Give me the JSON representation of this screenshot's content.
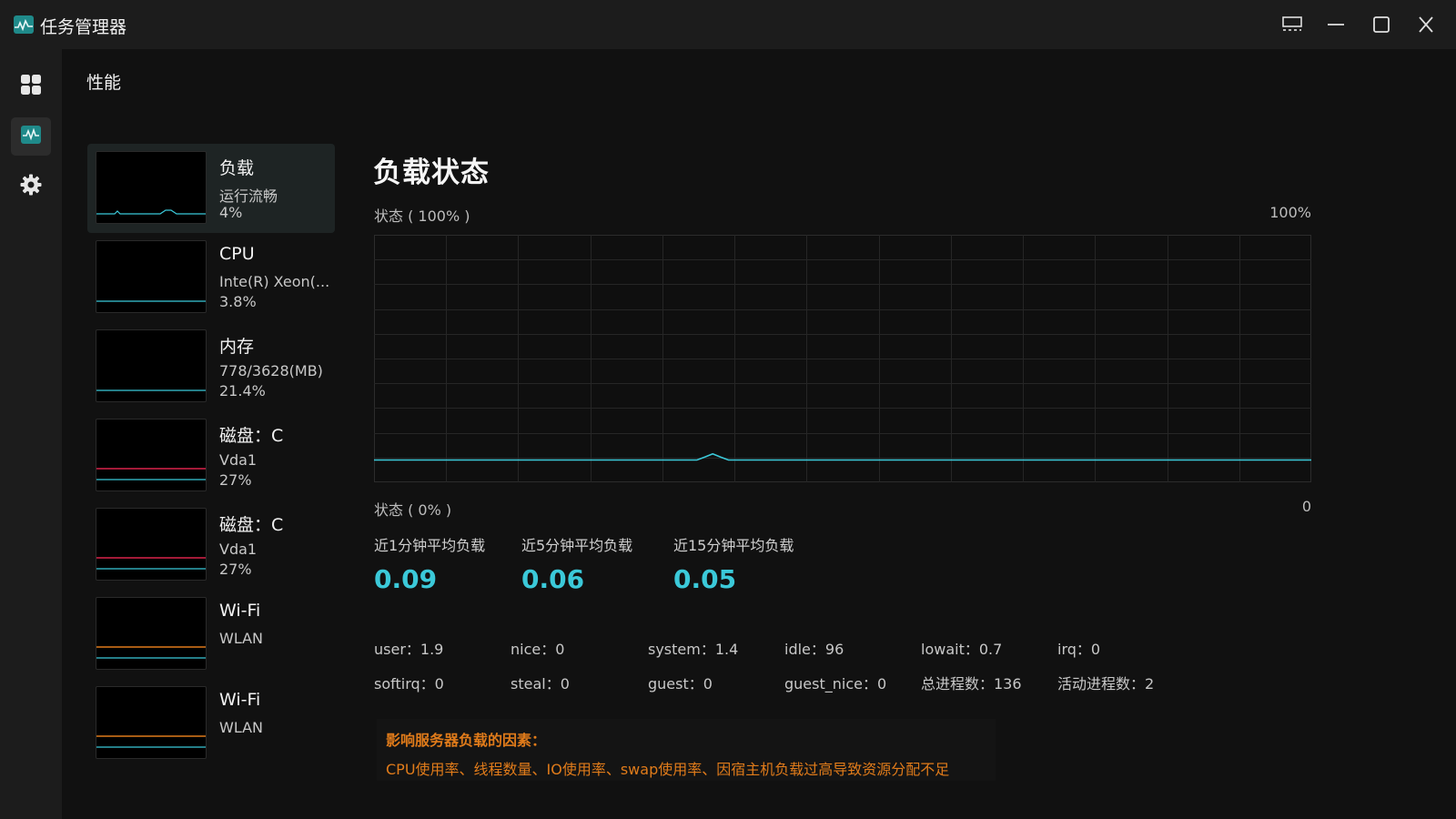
{
  "app": {
    "title": "任务管理器",
    "icon": "activity-icon",
    "accent": "#1f8a8a"
  },
  "window_controls": [
    "compact-view-icon",
    "minimize-icon",
    "maximize-icon",
    "close-icon"
  ],
  "rail": {
    "items": [
      {
        "icon": "grid-icon",
        "active": false
      },
      {
        "icon": "activity-icon",
        "active": true
      },
      {
        "icon": "gear-icon",
        "active": false
      }
    ]
  },
  "page": {
    "title": "性能"
  },
  "perf_list": [
    {
      "name": "负载",
      "sub": "运行流畅",
      "value": "4%",
      "line_colors": [
        "#3bc9d9"
      ]
    },
    {
      "name": "CPU",
      "sub": "Inte(R) Xeon(...",
      "value": "3.8%",
      "line_colors": [
        "#3bc9d9"
      ]
    },
    {
      "name": "内存",
      "sub": "778/3628(MB)",
      "value": "21.4%",
      "line_colors": [
        "#3bc9d9"
      ]
    },
    {
      "name": "磁盘：C",
      "sub": "Vda1",
      "value": "27%",
      "line_colors": [
        "#d9234a",
        "#3bc9d9"
      ]
    },
    {
      "name": "磁盘：C",
      "sub": "Vda1",
      "value": "27%",
      "line_colors": [
        "#d9234a",
        "#3bc9d9"
      ]
    },
    {
      "name": "Wi-Fi",
      "sub": "WLAN",
      "value": "",
      "line_colors": [
        "#e07b1a",
        "#3bc9d9"
      ]
    },
    {
      "name": "Wi-Fi",
      "sub": "WLAN",
      "value": "",
      "line_colors": [
        "#e07b1a",
        "#3bc9d9"
      ]
    }
  ],
  "chart": {
    "title": "负载状态",
    "top_left": "状态 ( 100% )",
    "top_right": "100%",
    "bottom_left": "状态 ( 0% )",
    "bottom_right": "0",
    "line_color": "#3bc9d9"
  },
  "chart_data": {
    "type": "line",
    "ylim": [
      0,
      100
    ],
    "grid": true,
    "series": [
      {
        "values": [
          9,
          9,
          9,
          9,
          9,
          9,
          9,
          9,
          9,
          9,
          9,
          9,
          9,
          9,
          9,
          9,
          9,
          9,
          9,
          9,
          9,
          9,
          9,
          9,
          9,
          9,
          9,
          9,
          9,
          9,
          9,
          9,
          9,
          9,
          9,
          9,
          9,
          9,
          9,
          9,
          9,
          9,
          9,
          9,
          9,
          9,
          9,
          9,
          9,
          9,
          9,
          9,
          9,
          9,
          9,
          9,
          9,
          9,
          9,
          9,
          9,
          9,
          9,
          9,
          9,
          9,
          9,
          9,
          9,
          9,
          9,
          9,
          9,
          9,
          9,
          9,
          9,
          9,
          9,
          9,
          9,
          9,
          9,
          9,
          9,
          9,
          9,
          9,
          9,
          9,
          9,
          9,
          9,
          9,
          9,
          9,
          9,
          9,
          9,
          9,
          9,
          9,
          9,
          9,
          9,
          9,
          9,
          9,
          9,
          9,
          9,
          9,
          9,
          9,
          9,
          9,
          9,
          9,
          9,
          9
        ]
      }
    ]
  },
  "load_avg": [
    {
      "label": "近1分钟平均负载",
      "value": "0.09"
    },
    {
      "label": "近5分钟平均负载",
      "value": "0.06"
    },
    {
      "label": "近15分钟平均负载",
      "value": "0.05"
    }
  ],
  "stats": [
    [
      "user：1.9",
      "nice：0",
      "system：1.4",
      "idle：96",
      "lowait：0.7",
      "irq：0"
    ],
    [
      "softirq：0",
      "steal：0",
      "guest：0",
      "guest_nice：0",
      "总进程数：136",
      "活动进程数：2"
    ]
  ],
  "notice": {
    "title": "影响服务器负载的因素：",
    "text": "CPU使用率、线程数量、IO使用率、swap使用率、因宿主机负载过高导致资源分配不足",
    "color": "#e07b1a"
  }
}
